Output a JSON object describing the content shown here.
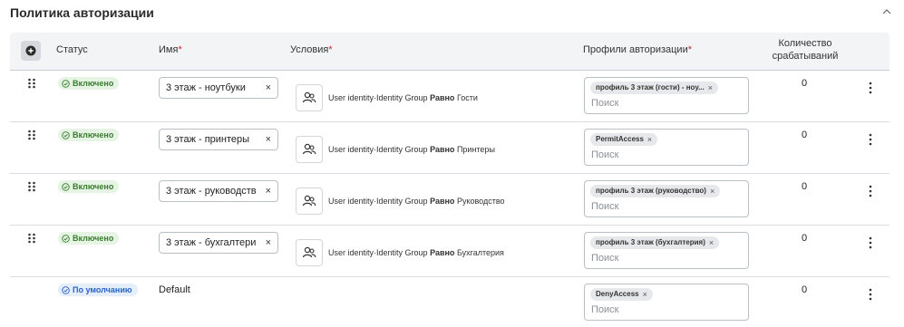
{
  "section": {
    "title": "Политика авторизации"
  },
  "header": {
    "status": "Статус",
    "name": "Имя",
    "conditions": "Условия",
    "profiles": "Профили авторизации",
    "count_line1": "Количество",
    "count_line2": "срабатываний",
    "required_mark": "*"
  },
  "rows": [
    {
      "status": "Включено",
      "name": "3 этаж - ноутбуки",
      "cond_prefix": "User identity·Identity Group",
      "cond_op": "Равно",
      "cond_value": "Гости",
      "profile": "профиль 3 этаж (гости) - ноу...",
      "search_placeholder": "Поиск",
      "count": "0"
    },
    {
      "status": "Включено",
      "name": "3 этаж - принтеры",
      "cond_prefix": "User identity·Identity Group",
      "cond_op": "Равно",
      "cond_value": "Принтеры",
      "profile": "PermitAccess",
      "search_placeholder": "Поиск",
      "count": "0"
    },
    {
      "status": "Включено",
      "name": "3 этаж - руководств",
      "cond_prefix": "User identity·Identity Group",
      "cond_op": "Равно",
      "cond_value": "Руководство",
      "profile": "профиль 3 этаж (руководство)",
      "search_placeholder": "Поиск",
      "count": "0"
    },
    {
      "status": "Включено",
      "name": "3 этаж - бухгалтери",
      "cond_prefix": "User identity·Identity Group",
      "cond_op": "Равно",
      "cond_value": "Бухгалтерия",
      "profile": "профиль 3 этаж (бухгалтерия)",
      "search_placeholder": "Поиск",
      "count": "0"
    },
    {
      "status": "По умолчанию",
      "name": "Default",
      "profile": "DenyAccess",
      "search_placeholder": "Поиск",
      "count": "0"
    }
  ],
  "icons": {
    "collapse": "chevron-up-icon",
    "add": "plus-circle-icon",
    "drag": "drag-handle-icon",
    "status_on": "check-circle-icon",
    "condition": "user-group-icon",
    "remove": "close-icon",
    "menu": "kebab-menu-icon"
  },
  "colors": {
    "status_on_bg": "#e5f4e3",
    "status_on_text": "#3a7d2e",
    "status_default_bg": "#e4eefc",
    "status_default_text": "#2a63c6",
    "required": "#c9252d"
  }
}
